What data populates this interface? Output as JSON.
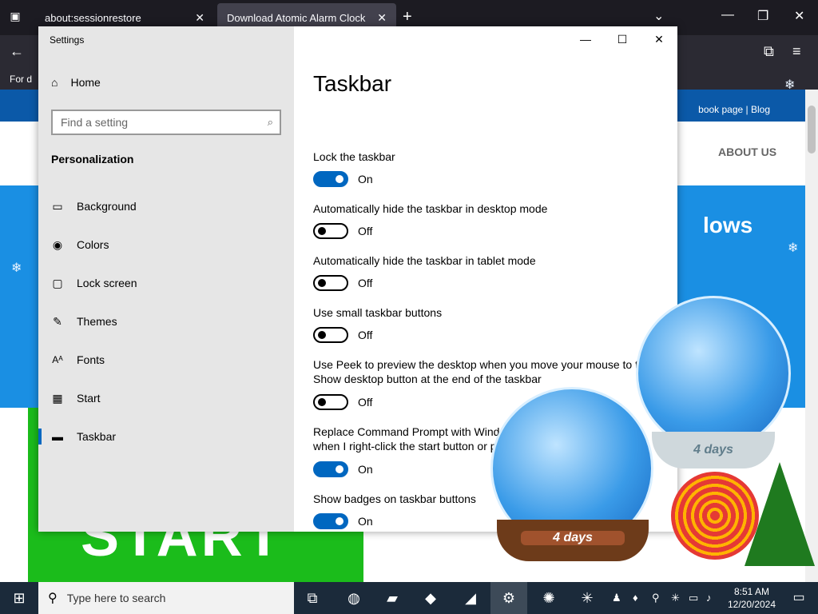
{
  "browser": {
    "tabs": [
      {
        "label": "about:sessionrestore"
      },
      {
        "label": "Download Atomic Alarm Clock"
      }
    ],
    "new_tab": "+",
    "page": {
      "top_links": "book page | Blog",
      "nav_about": "ABOUT US",
      "blue_title": "lows",
      "start_text": "START",
      "left_text": "For d"
    }
  },
  "settings": {
    "window_title": "Settings",
    "controls": {
      "minimize": "—",
      "maximize": "☐",
      "close": "✕"
    },
    "nav": {
      "home_label": "Home",
      "search_placeholder": "Find a setting",
      "section_title": "Personalization",
      "items": [
        {
          "label": "Background",
          "icon": "image-icon"
        },
        {
          "label": "Colors",
          "icon": "palette-icon"
        },
        {
          "label": "Lock screen",
          "icon": "lock-screen-icon"
        },
        {
          "label": "Themes",
          "icon": "themes-icon"
        },
        {
          "label": "Fonts",
          "icon": "fonts-icon"
        },
        {
          "label": "Start",
          "icon": "start-icon"
        },
        {
          "label": "Taskbar",
          "icon": "taskbar-icon",
          "active": true
        }
      ]
    },
    "page_title": "Taskbar",
    "options": [
      {
        "label": "Lock the taskbar",
        "state": "On",
        "on": true
      },
      {
        "label": "Automatically hide the taskbar in desktop mode",
        "state": "Off",
        "on": false
      },
      {
        "label": "Automatically hide the taskbar in tablet mode",
        "state": "Off",
        "on": false
      },
      {
        "label": "Use small taskbar buttons",
        "state": "Off",
        "on": false
      },
      {
        "label": "Use Peek to preview the desktop when you move your mouse to the Show desktop button at the end of the taskbar",
        "state": "Off",
        "on": false
      },
      {
        "label": "Replace Command Prompt with Windows PowerShell in the menu when I right-click the start button or press Windows key + X",
        "state": "On",
        "on": true
      },
      {
        "label": "Show badges on taskbar buttons",
        "state": "On",
        "on": true
      }
    ]
  },
  "decorations": {
    "globe_left_label": "4 days",
    "globe_right_label": "4 days"
  },
  "taskbar": {
    "search_placeholder": "Type here to search",
    "clock_time": "8:51 AM",
    "clock_date": "12/20/2024"
  },
  "colors": {
    "accent": "#0067c0",
    "nav_bg": "#e6e6e6",
    "taskbar_bg": "#1b2a3a"
  }
}
